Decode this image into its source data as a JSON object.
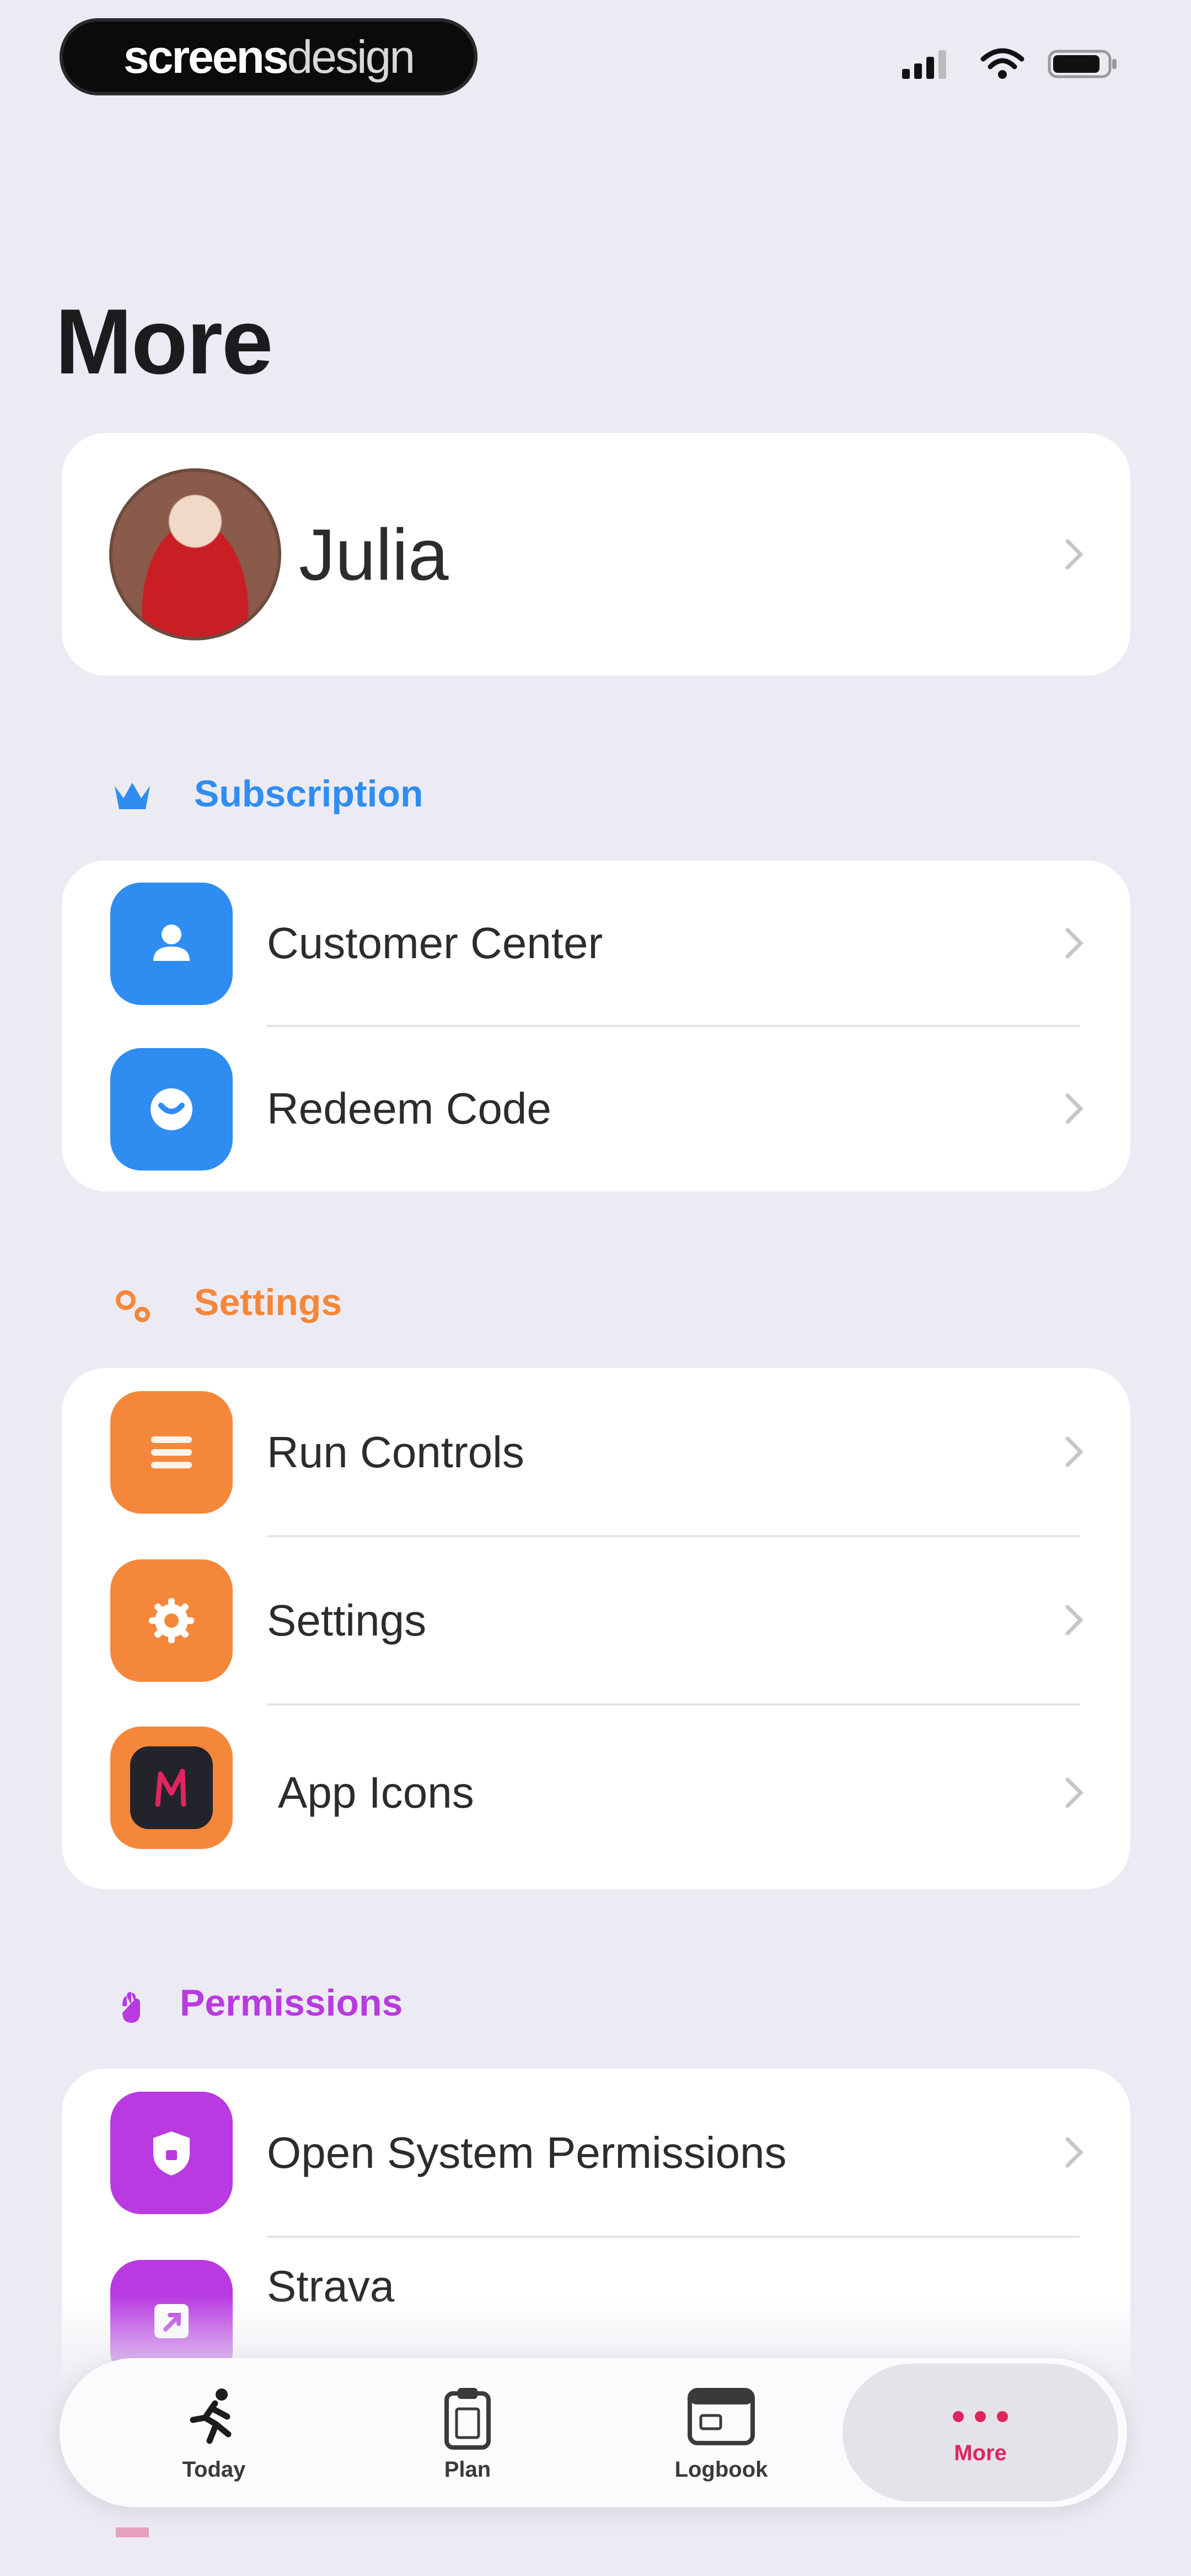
{
  "status_bar": {
    "brand_bold": "screens",
    "brand_light": "design"
  },
  "page": {
    "title": "More"
  },
  "profile": {
    "name": "Julia"
  },
  "sections": {
    "subscription": {
      "label": "Subscription",
      "color": "#2f8df2",
      "items": [
        {
          "label": "Customer Center",
          "icon": "person-icon"
        },
        {
          "label": "Redeem Code",
          "icon": "gift-icon"
        }
      ]
    },
    "settings": {
      "label": "Settings",
      "color": "#f5873a",
      "items": [
        {
          "label": "Run Controls",
          "icon": "list-icon"
        },
        {
          "label": "Settings",
          "icon": "gear-icon"
        },
        {
          "label": "App Icons",
          "icon": "app-icon"
        }
      ]
    },
    "permissions": {
      "label": "Permissions",
      "color": "#b83ae0",
      "items": [
        {
          "label": "Open System Permissions",
          "icon": "shield-icon"
        },
        {
          "label": "Strava",
          "icon": "share-icon"
        }
      ]
    }
  },
  "tab_bar": {
    "tabs": [
      {
        "label": "Today",
        "icon": "runner-icon",
        "active": false
      },
      {
        "label": "Plan",
        "icon": "clipboard-icon",
        "active": false
      },
      {
        "label": "Logbook",
        "icon": "calendar-icon",
        "active": false
      },
      {
        "label": "More",
        "icon": "more-dots-icon",
        "active": true
      }
    ],
    "active_color": "#e0245e"
  }
}
